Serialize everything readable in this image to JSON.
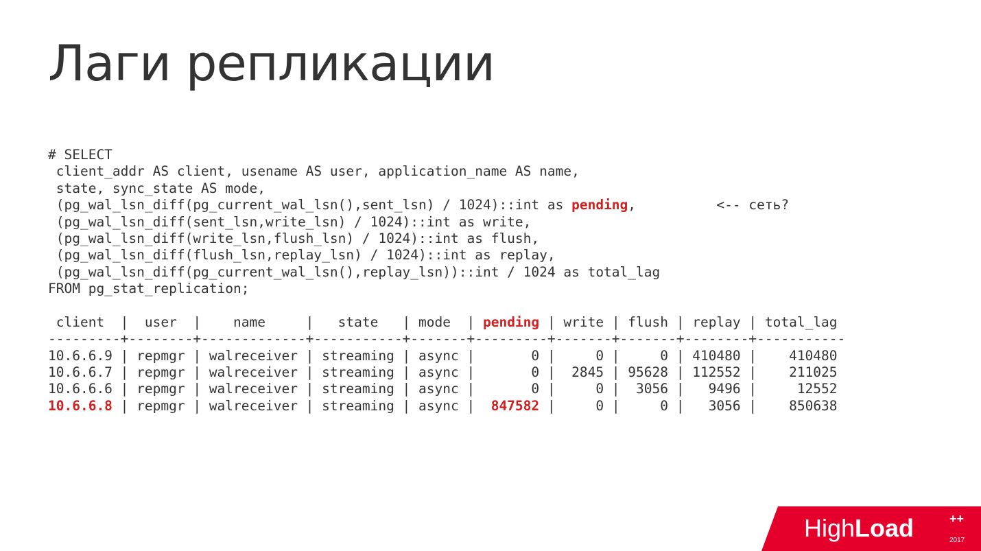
{
  "title": "Лаги репликации",
  "sql": {
    "l1": "# SELECT",
    "l2": " client_addr AS client, usename AS user, application_name AS name,",
    "l3": " state, sync_state AS mode,",
    "l4a": " (pg_wal_lsn_diff(pg_current_wal_lsn(),sent_lsn) / 1024)::int as ",
    "l4hl": "pending",
    "l4b": ",          <-- сеть?",
    "l5": " (pg_wal_lsn_diff(sent_lsn,write_lsn) / 1024)::int as write,",
    "l6": " (pg_wal_lsn_diff(write_lsn,flush_lsn) / 1024)::int as flush,",
    "l7": " (pg_wal_lsn_diff(flush_lsn,replay_lsn) / 1024)::int as replay,",
    "l8": " (pg_wal_lsn_diff(pg_current_wal_lsn(),replay_lsn))::int / 1024 as total_lag",
    "l9": "FROM pg_stat_replication;"
  },
  "table": {
    "hdr_a": " client  |  user  |    name     |   state   | mode  | ",
    "hdr_hl": "pending",
    "hdr_b": " | write | flush | replay | total_lag",
    "sep": "---------+--------+-------------+-----------+-------+---------+-------+-------+--------+-----------",
    "r1": "10.6.6.9 | repmgr | walreceiver | streaming | async |       0 |     0 |     0 | 410480 |    410480",
    "r2": "10.6.6.7 | repmgr | walreceiver | streaming | async |       0 |  2845 | 95628 | 112552 |    211025",
    "r3": "10.6.6.6 | repmgr | walreceiver | streaming | async |       0 |     0 |  3056 |   9496 |     12552",
    "r4_client": "10.6.6.8",
    "r4_mid": " | repmgr | walreceiver | streaming | async |  ",
    "r4_pending": "847582",
    "r4_rest": " |     0 |     0 |   3056 |    850638"
  },
  "logo": {
    "brand_prefix": "High",
    "brand_emph": "Load",
    "year": "2017",
    "plus": "++"
  },
  "colors": {
    "highlight": "#d02020",
    "logo_bg": "#e4002b"
  }
}
